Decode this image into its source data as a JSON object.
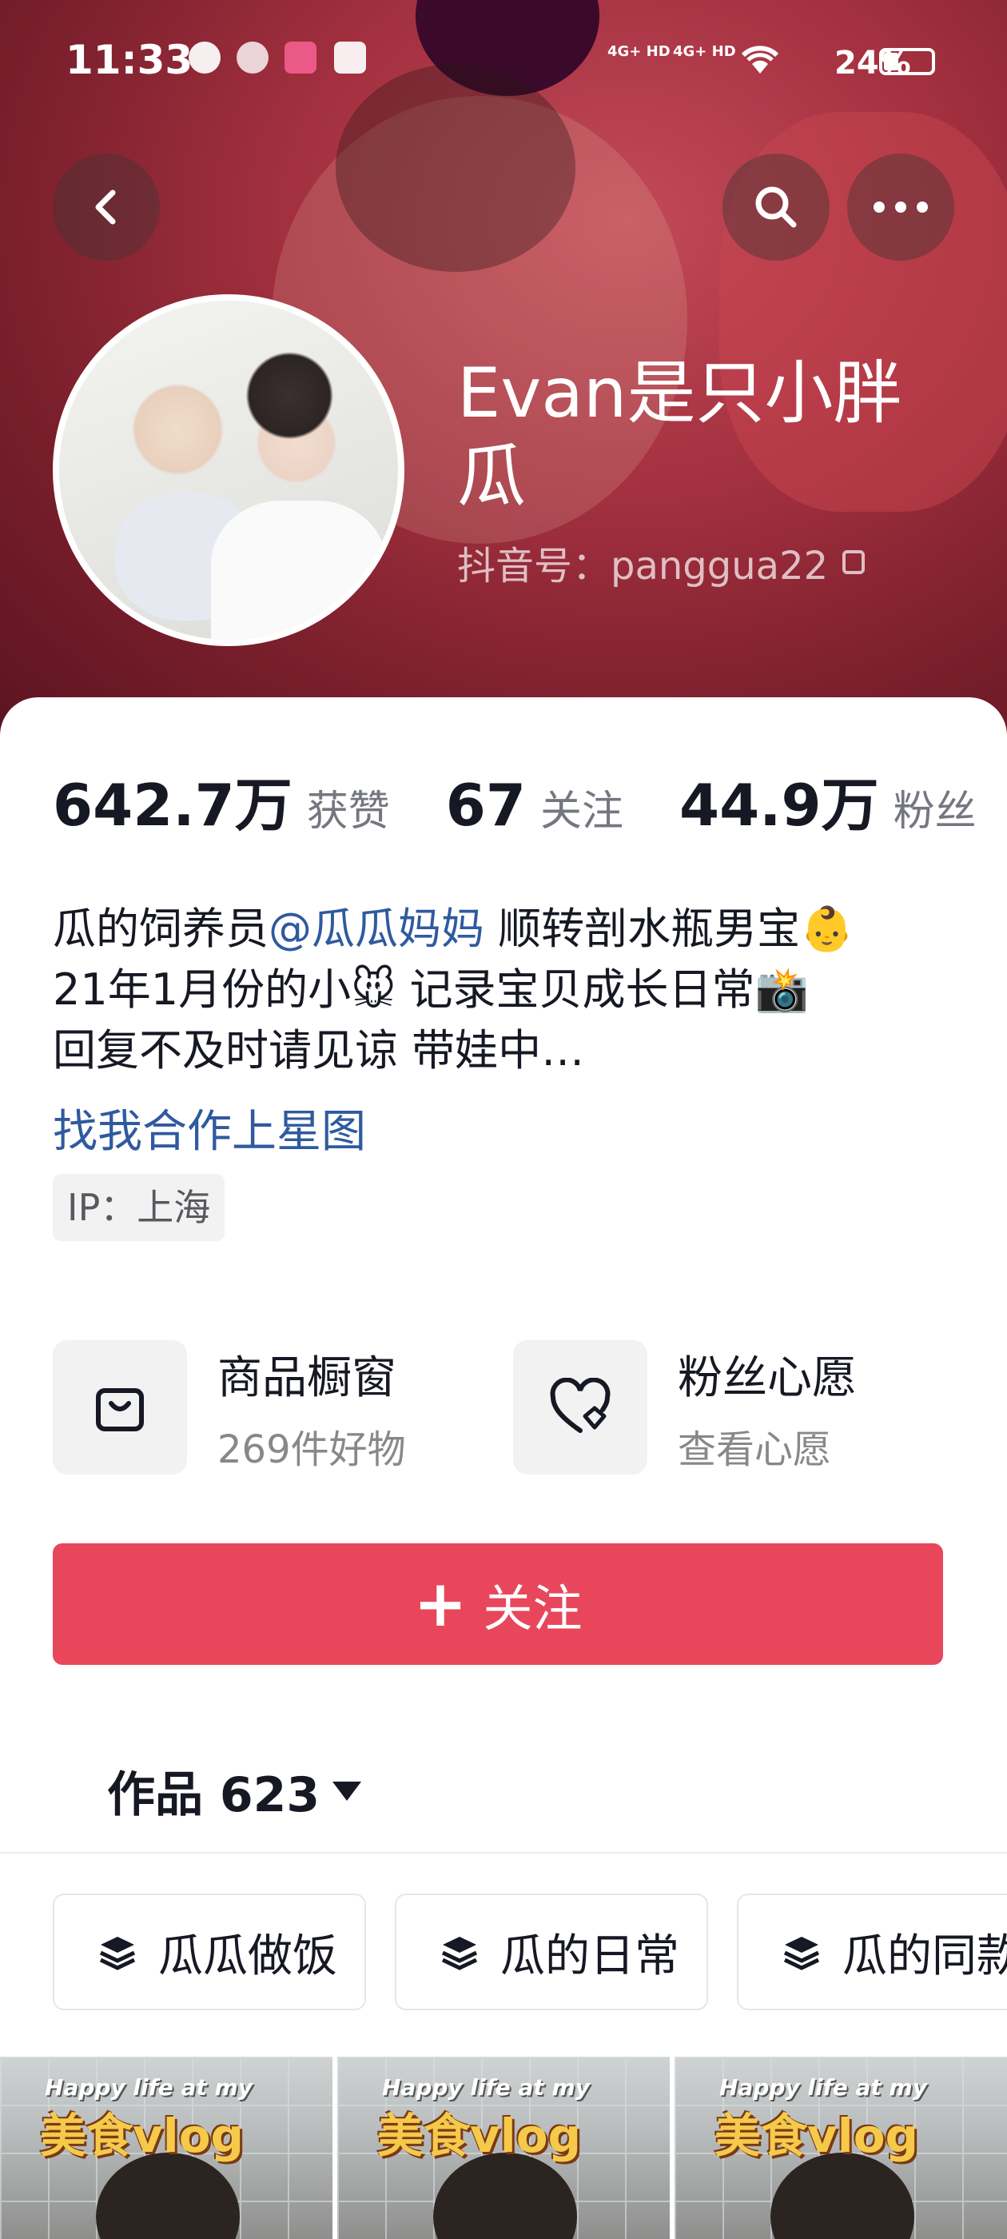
{
  "status_bar": {
    "time": "11:33",
    "signal1": "4G+ HD",
    "signal2": "4G+ HD",
    "battery": "24%"
  },
  "profile": {
    "name": "Evan是只小胖瓜",
    "douyin_id": "抖音号：panggua22"
  },
  "stats": [
    {
      "value": "642.7万",
      "label": "获赞"
    },
    {
      "value": "67",
      "label": "关注"
    },
    {
      "value": "44.9万",
      "label": "粉丝"
    }
  ],
  "bio": {
    "line1_prefix": "瓜的饲养员",
    "line1_mention": "@瓜瓜妈妈",
    "line1_suffix": " 顺转剖水瓶男宝👶",
    "line2": "21年1月份的小🐭 记录宝贝成长日常📸",
    "line3": "回复不及时请见谅 带娃中…",
    "link": "找我合作上星图",
    "ip": "IP：上海"
  },
  "features": [
    {
      "title": "商品橱窗",
      "sub": "269件好物",
      "icon": "shopping-bag-icon"
    },
    {
      "title": "粉丝心愿",
      "sub": "查看心愿",
      "icon": "heart-wish-icon"
    }
  ],
  "follow_button": {
    "plus": "+",
    "label": "关注"
  },
  "works_tab": {
    "label": "作品 623"
  },
  "collections": [
    "瓜瓜做饭",
    "瓜的日常",
    "瓜的同款"
  ],
  "thumbnails": [
    {
      "caption_top": "Happy life at my",
      "caption_main": "美食vlog"
    },
    {
      "caption_top": "Happy life at my",
      "caption_main": "美食vlog"
    },
    {
      "caption_top": "Happy life at my",
      "caption_main": "美食vlog"
    }
  ]
}
